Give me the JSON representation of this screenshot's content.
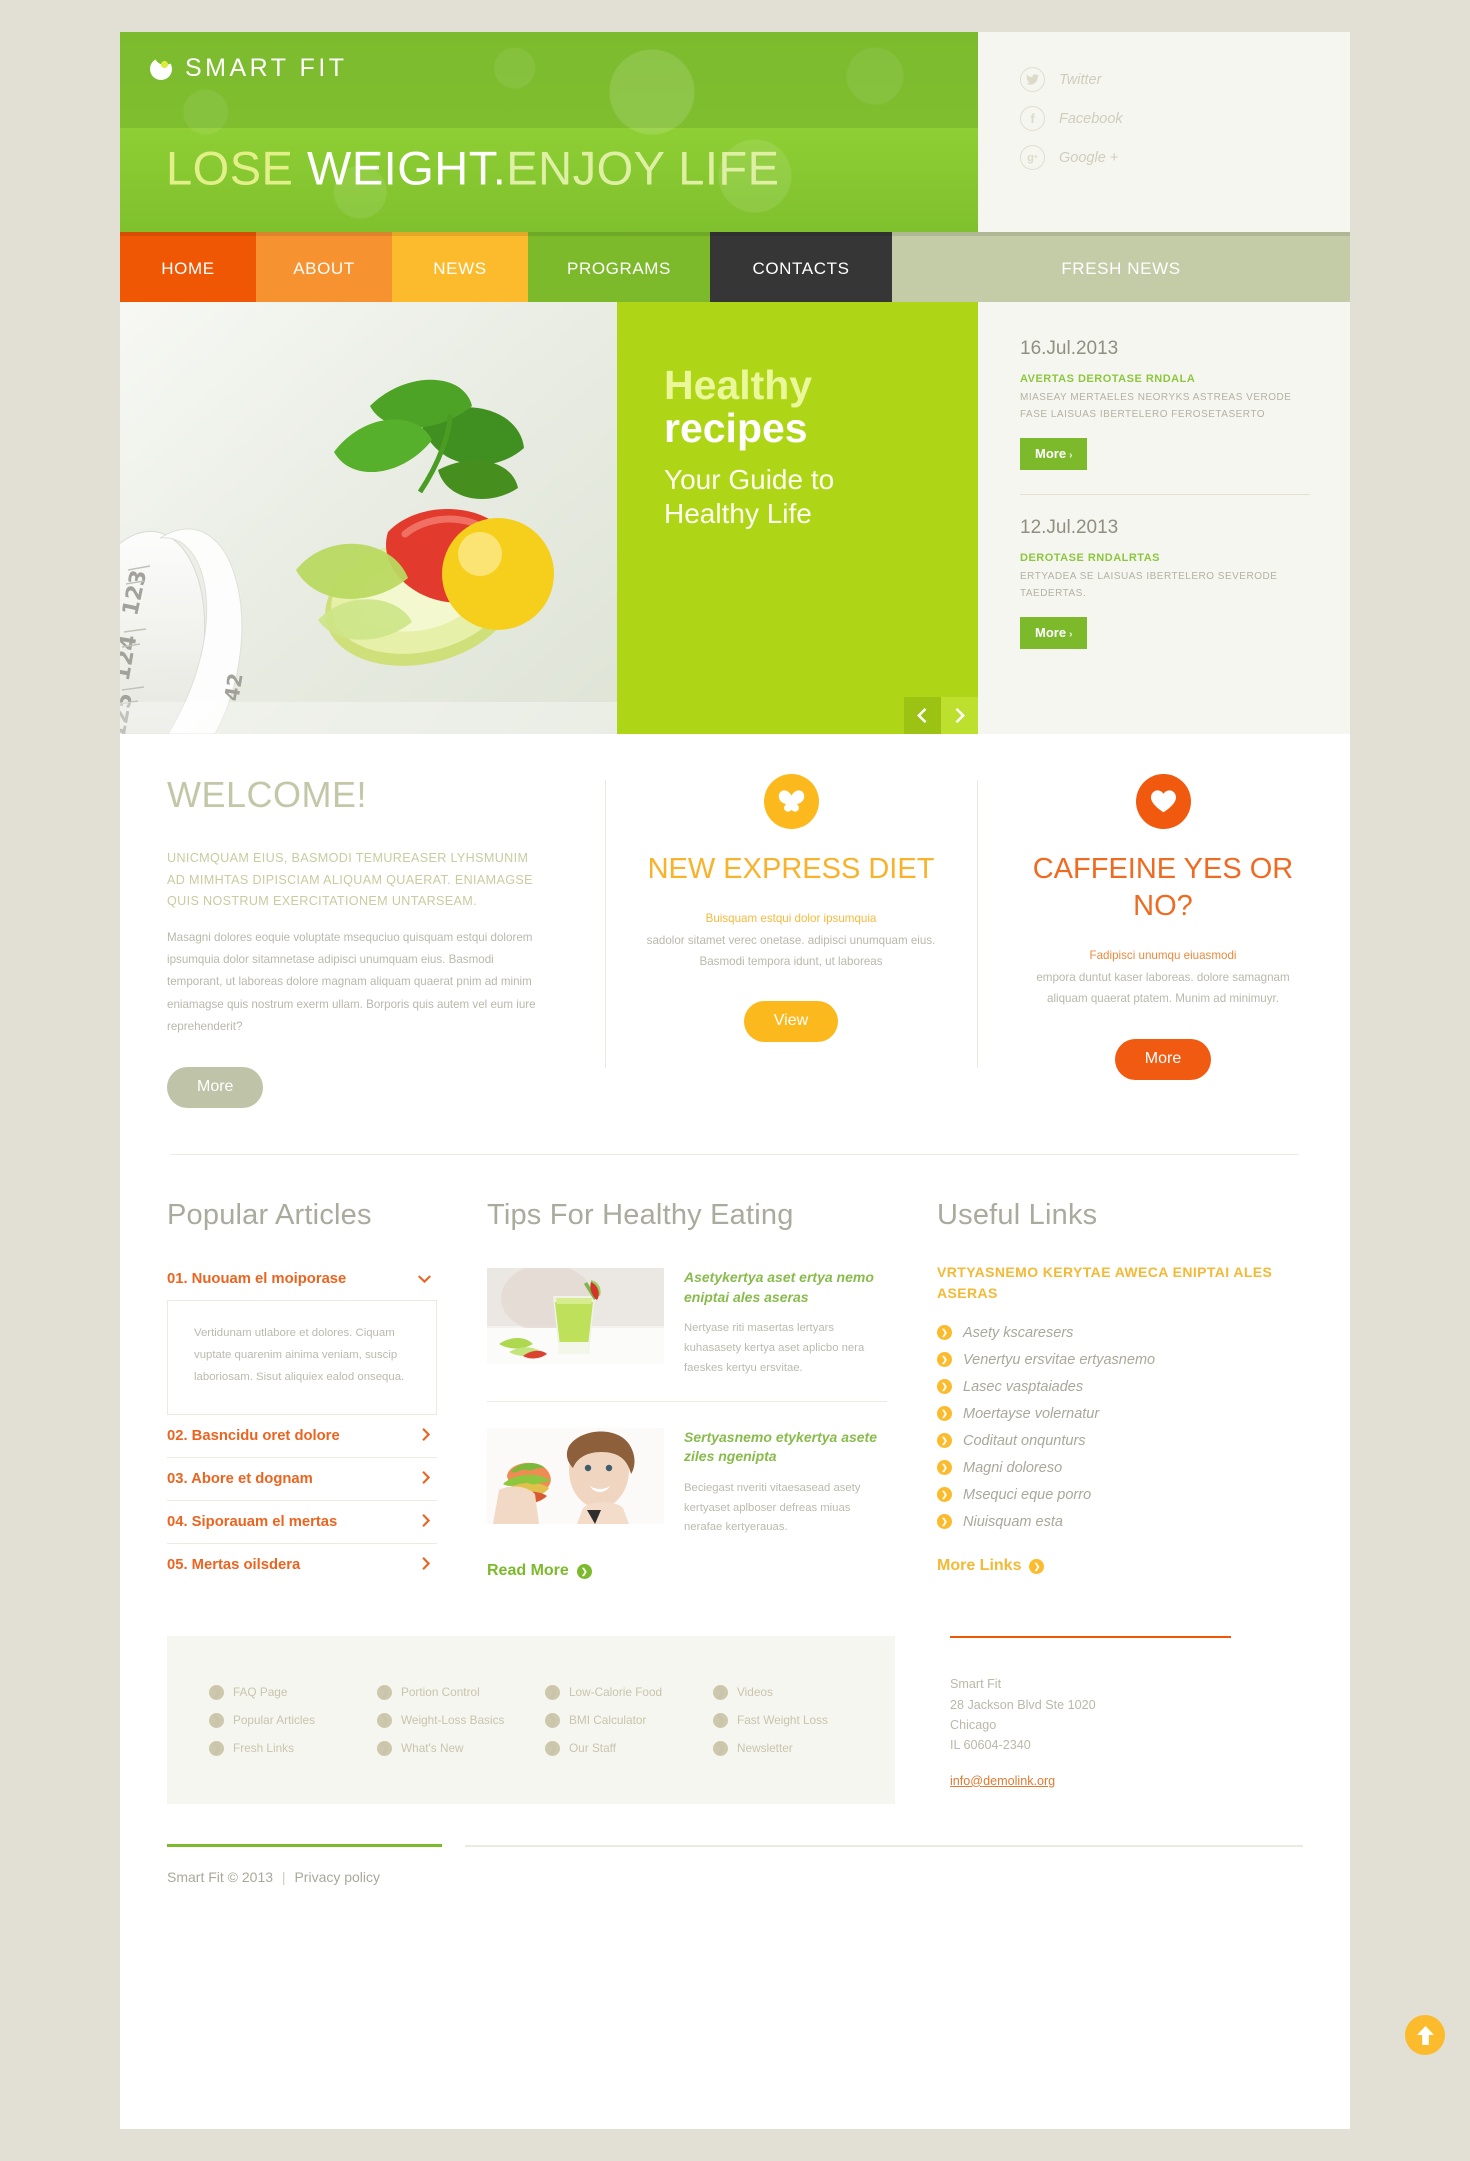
{
  "brand": {
    "name": "SMART FIT",
    "logo_icon": "crescent-dot-logo"
  },
  "hero_headline": {
    "part1": "LOSE ",
    "part2": "WEIGHT.",
    "part3": "ENJOY LIFE"
  },
  "social": [
    {
      "icon": "twitter-icon",
      "glyph": "★",
      "label": "Twitter"
    },
    {
      "icon": "facebook-icon",
      "glyph": "f",
      "label": "Facebook"
    },
    {
      "icon": "google-plus-icon",
      "glyph": "g",
      "label": "Google +"
    }
  ],
  "nav": [
    {
      "label": "HOME",
      "color": "#ef5704"
    },
    {
      "label": "ABOUT",
      "color": "#f79231"
    },
    {
      "label": "NEWS",
      "color": "#fcbb2c"
    },
    {
      "label": "PROGRAMS",
      "color": "#7cba2c"
    },
    {
      "label": "CONTACTS",
      "color": "#363636"
    },
    {
      "label": "FRESH NEWS",
      "color": "#c3cca6"
    }
  ],
  "slider": {
    "title_line1": "Healthy",
    "title_line2": "recipes",
    "subtitle_line1": "Your Guide to",
    "subtitle_line2": "Healthy Life",
    "prev_icon": "chevron-left-icon",
    "next_icon": "chevron-right-icon",
    "prev_glyph": "‹",
    "next_glyph": "›"
  },
  "news": [
    {
      "date": "16.Jul.2013",
      "heading": "AVERTAS DEROTASE RNDALA",
      "body": "MIASEAY MERTAELES NEORYKS ASTREAS VERODE FASE LAISUAS IBERTELERO FEROSETASERTO",
      "button": "More",
      "button_arrow": "›"
    },
    {
      "date": "12.Jul.2013",
      "heading": "DEROTASE RNDALRTAS",
      "body": "ERTYADEA SE LAISUAS IBERTELERO SEVERODE TAEDERTAS.",
      "button": "More",
      "button_arrow": "›"
    }
  ],
  "welcome": {
    "title": "WELCOME!",
    "lead": "UNICMQUAM EIUS, BASMODI TEMUREASER  LYHSMUNIM AD MIMHTAS DIPISCIAM ALIQUAM QUAERAT. ENIAMAGSE QUIS NOSTRUM EXERCITATIONEM UNTARSEAM.",
    "body": "Masagni dolores eoquie voluptate msequciuo quisquam estqui dolorem ipsumquia dolor sitamnetase adipisci unumquam eius. Basmodi temporant, ut laboreas dolore magnam aliquam quaerat pnim ad minim eniamagse quis nostrum exerm ullam. Borporis quis autem vel eum iure reprehenderit?",
    "button": "More"
  },
  "features": [
    {
      "icon": "butterfly-icon",
      "glyph": "❦",
      "icon_color": "#fcb91e",
      "title": "NEW EXPRESS DIET",
      "highlight": "Buisquam estqui dolor ipsumquia",
      "text": "sadolor sitamet verec onetase. adipisci unumquam eius. Basmodi tempora idunt, ut laboreas",
      "button": "View",
      "button_color": "#fcb91e"
    },
    {
      "icon": "heart-icon",
      "glyph": "♥",
      "icon_color": "#f1590e",
      "title": "CAFFEINE YES OR NO?",
      "highlight": "Fadipisci unumqu eiuasmodi",
      "text": "empora duntut kaser laboreas. dolore samagnam aliquam quaerat ptatem. Munim ad minimuyr.",
      "button": "More",
      "button_color": "#f15a11"
    }
  ],
  "popular_articles": {
    "title": "Popular Articles",
    "items": [
      {
        "label": "01. Nuouam el moiporase",
        "icon": "chevron-down-icon",
        "glyph": "⌄",
        "open": true,
        "panel": "Vertidunam utlabore et dolores. Ciquam vuptate quarenim ainima veniam, suscip laboriosam. Sisut aliquiex ealod onsequa."
      },
      {
        "label": "02. Basncidu oret dolore",
        "icon": "chevron-right-icon",
        "glyph": "›",
        "open": false,
        "panel": ""
      },
      {
        "label": "03. Abore et dognam",
        "icon": "chevron-right-icon",
        "glyph": "›",
        "open": false,
        "panel": ""
      },
      {
        "label": "04. Siporauam el mertas",
        "icon": "chevron-right-icon",
        "glyph": "›",
        "open": false,
        "panel": ""
      },
      {
        "label": "05. Mertas oilsdera",
        "icon": "chevron-right-icon",
        "glyph": "›",
        "open": false,
        "panel": ""
      }
    ]
  },
  "tips": {
    "title": "Tips For Healthy Eating",
    "items": [
      {
        "image": "green-smoothie-photo",
        "heading": "Asetykertya aset ertya nemo eniptai ales aseras",
        "text": "Nertyase riti masertas lertyars kuhasasety kertya aset aplicbo nera faeskes kertyu ersvitae."
      },
      {
        "image": "woman-with-burger-photo",
        "heading": "Sertyasnemo etykertya asete ziles ngenipta",
        "text": "Beciegast nveriti vitaesasead asety kertyaset aplboser defreas miuas nerafae kertyerauas."
      }
    ],
    "read_more": "Read More"
  },
  "useful_links": {
    "title": "Useful Links",
    "heading": "VRTYASNEMO KERYTAE AWECA ENIPTAI ALES ASERAS",
    "items": [
      "Asety kscaresers",
      "Venertyu ersvitae ertyasnemo",
      "Lasec vasptaiades",
      "Moertayse volernatur",
      "Coditaut onqunturs",
      "Magni doloreso",
      "Msequci eque porro",
      "Niuisquam esta"
    ],
    "more": "More Links"
  },
  "footer_links": [
    [
      "FAQ Page",
      "Popular Articles",
      "Fresh Links"
    ],
    [
      "Portion Control",
      "Weight-Loss Basics",
      "What's New"
    ],
    [
      "Low-Calorie Food",
      "BMI Calculator",
      "Our Staff"
    ],
    [
      "Videos",
      "Fast Weight Loss",
      "Newsletter"
    ]
  ],
  "address": {
    "line1": "Smart Fit",
    "line2": "28 Jackson Blvd Ste 1020",
    "line3": "Chicago",
    "line4": "IL 60604-2340",
    "email": "info@demolink.org"
  },
  "copyright": {
    "text": "Smart Fit © 2013",
    "separator": "|",
    "privacy": "Privacy policy"
  },
  "to_top": {
    "icon": "arrow-up-icon",
    "glyph": "↑"
  }
}
